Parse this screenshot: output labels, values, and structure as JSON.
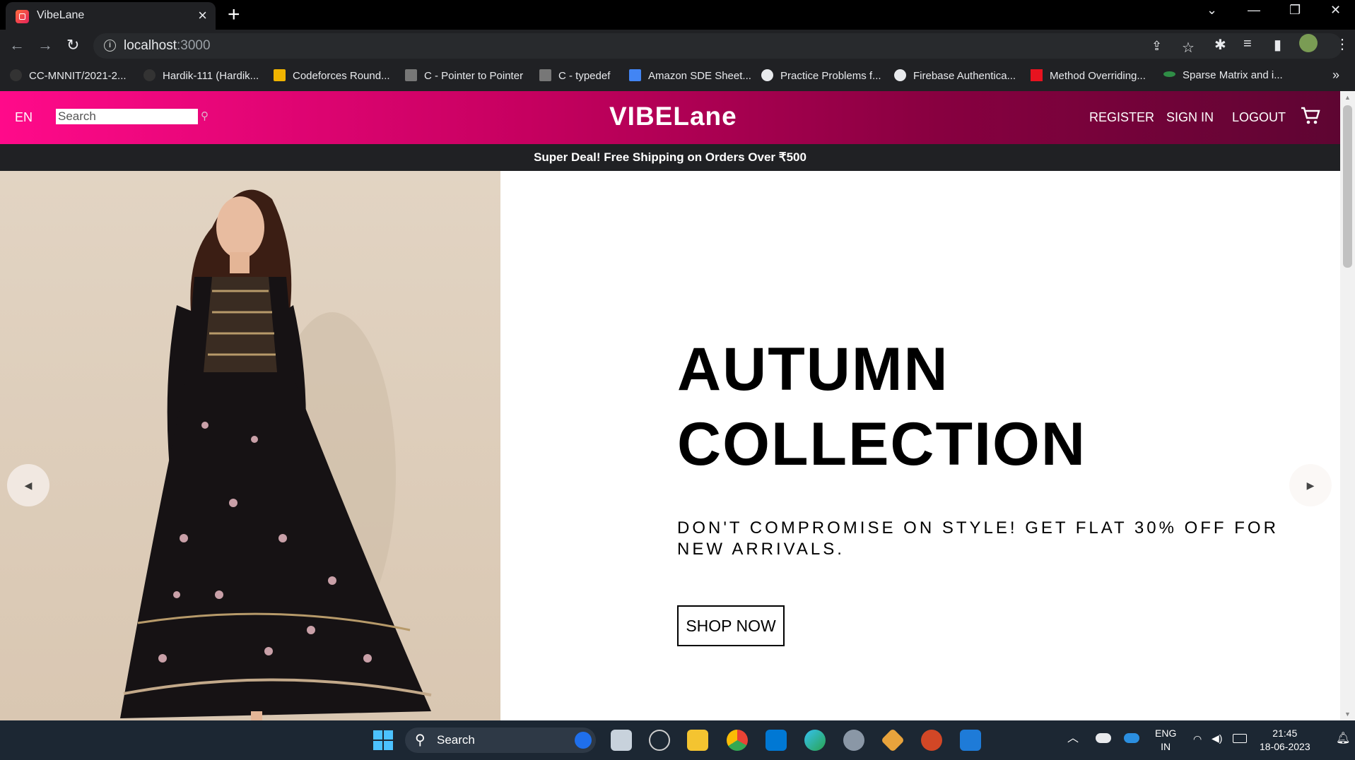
{
  "browser": {
    "tab_title": "VibeLane",
    "url_host": "localhost",
    "url_port": ":3000",
    "bookmarks": [
      {
        "label": "CC-MNNIT/2021-2...",
        "color": "#333"
      },
      {
        "label": "Hardik-111 (Hardik...",
        "color": "#333"
      },
      {
        "label": "Codeforces Round...",
        "color": "#f0b400"
      },
      {
        "label": "C - Pointer to Pointer",
        "color": "#555"
      },
      {
        "label": "C - typedef",
        "color": "#555"
      },
      {
        "label": "Amazon SDE Sheet...",
        "color": "#4285f4"
      },
      {
        "label": "Practice Problems f...",
        "color": "#fff"
      },
      {
        "label": "Firebase Authentica...",
        "color": "#fff"
      },
      {
        "label": "Method Overriding...",
        "color": "#e8131f"
      },
      {
        "label": "Sparse Matrix and i...",
        "color": "#2f8d46"
      }
    ]
  },
  "site": {
    "lang": "EN",
    "search_placeholder": "Search",
    "logo": "VIBELane",
    "menu": {
      "register": "REGISTER",
      "sign_in": "SIGN IN",
      "logout": "LOGOUT"
    },
    "announcement": "Super Deal! Free Shipping on Orders Over ₹500",
    "hero": {
      "title_line1": "AUTUMN",
      "title_line2": "COLLECTION",
      "description": "DON'T COMPROMISE ON STYLE! GET FLAT 30% OFF FOR NEW ARRIVALS.",
      "button": "SHOP NOW"
    },
    "colors": {
      "header_start": "#ff0a8a",
      "header_end": "#5e0532",
      "announcement_bg": "#202124"
    }
  },
  "taskbar": {
    "search_label": "Search",
    "lang_line1": "ENG",
    "lang_line2": "IN",
    "time": "21:45",
    "date": "18-06-2023"
  }
}
